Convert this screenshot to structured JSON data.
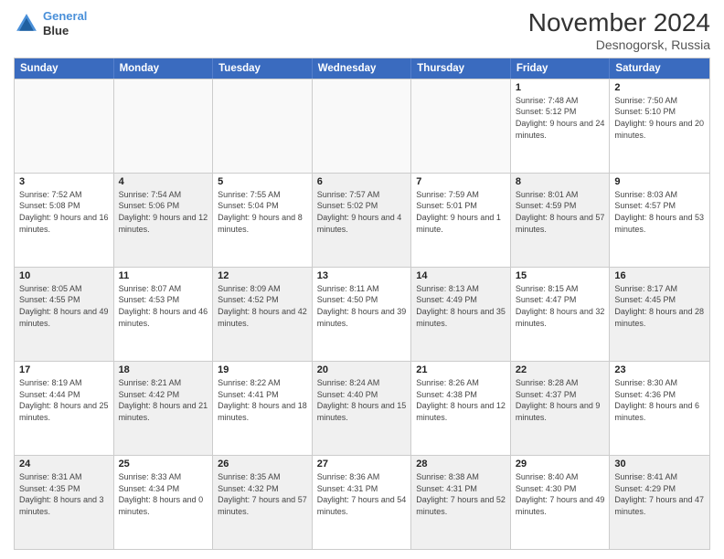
{
  "header": {
    "logo_line1": "General",
    "logo_line2": "Blue",
    "title": "November 2024",
    "subtitle": "Desnogorsk, Russia"
  },
  "days_of_week": [
    "Sunday",
    "Monday",
    "Tuesday",
    "Wednesday",
    "Thursday",
    "Friday",
    "Saturday"
  ],
  "weeks": [
    [
      {
        "day": "",
        "empty": true
      },
      {
        "day": "",
        "empty": true
      },
      {
        "day": "",
        "empty": true
      },
      {
        "day": "",
        "empty": true
      },
      {
        "day": "",
        "empty": true
      },
      {
        "day": "1",
        "info": "Sunrise: 7:48 AM\nSunset: 5:12 PM\nDaylight: 9 hours and 24 minutes."
      },
      {
        "day": "2",
        "info": "Sunrise: 7:50 AM\nSunset: 5:10 PM\nDaylight: 9 hours and 20 minutes."
      }
    ],
    [
      {
        "day": "3",
        "info": "Sunrise: 7:52 AM\nSunset: 5:08 PM\nDaylight: 9 hours and 16 minutes."
      },
      {
        "day": "4",
        "info": "Sunrise: 7:54 AM\nSunset: 5:06 PM\nDaylight: 9 hours and 12 minutes."
      },
      {
        "day": "5",
        "info": "Sunrise: 7:55 AM\nSunset: 5:04 PM\nDaylight: 9 hours and 8 minutes."
      },
      {
        "day": "6",
        "info": "Sunrise: 7:57 AM\nSunset: 5:02 PM\nDaylight: 9 hours and 4 minutes."
      },
      {
        "day": "7",
        "info": "Sunrise: 7:59 AM\nSunset: 5:01 PM\nDaylight: 9 hours and 1 minute."
      },
      {
        "day": "8",
        "info": "Sunrise: 8:01 AM\nSunset: 4:59 PM\nDaylight: 8 hours and 57 minutes."
      },
      {
        "day": "9",
        "info": "Sunrise: 8:03 AM\nSunset: 4:57 PM\nDaylight: 8 hours and 53 minutes."
      }
    ],
    [
      {
        "day": "10",
        "info": "Sunrise: 8:05 AM\nSunset: 4:55 PM\nDaylight: 8 hours and 49 minutes."
      },
      {
        "day": "11",
        "info": "Sunrise: 8:07 AM\nSunset: 4:53 PM\nDaylight: 8 hours and 46 minutes."
      },
      {
        "day": "12",
        "info": "Sunrise: 8:09 AM\nSunset: 4:52 PM\nDaylight: 8 hours and 42 minutes."
      },
      {
        "day": "13",
        "info": "Sunrise: 8:11 AM\nSunset: 4:50 PM\nDaylight: 8 hours and 39 minutes."
      },
      {
        "day": "14",
        "info": "Sunrise: 8:13 AM\nSunset: 4:49 PM\nDaylight: 8 hours and 35 minutes."
      },
      {
        "day": "15",
        "info": "Sunrise: 8:15 AM\nSunset: 4:47 PM\nDaylight: 8 hours and 32 minutes."
      },
      {
        "day": "16",
        "info": "Sunrise: 8:17 AM\nSunset: 4:45 PM\nDaylight: 8 hours and 28 minutes."
      }
    ],
    [
      {
        "day": "17",
        "info": "Sunrise: 8:19 AM\nSunset: 4:44 PM\nDaylight: 8 hours and 25 minutes."
      },
      {
        "day": "18",
        "info": "Sunrise: 8:21 AM\nSunset: 4:42 PM\nDaylight: 8 hours and 21 minutes."
      },
      {
        "day": "19",
        "info": "Sunrise: 8:22 AM\nSunset: 4:41 PM\nDaylight: 8 hours and 18 minutes."
      },
      {
        "day": "20",
        "info": "Sunrise: 8:24 AM\nSunset: 4:40 PM\nDaylight: 8 hours and 15 minutes."
      },
      {
        "day": "21",
        "info": "Sunrise: 8:26 AM\nSunset: 4:38 PM\nDaylight: 8 hours and 12 minutes."
      },
      {
        "day": "22",
        "info": "Sunrise: 8:28 AM\nSunset: 4:37 PM\nDaylight: 8 hours and 9 minutes."
      },
      {
        "day": "23",
        "info": "Sunrise: 8:30 AM\nSunset: 4:36 PM\nDaylight: 8 hours and 6 minutes."
      }
    ],
    [
      {
        "day": "24",
        "info": "Sunrise: 8:31 AM\nSunset: 4:35 PM\nDaylight: 8 hours and 3 minutes."
      },
      {
        "day": "25",
        "info": "Sunrise: 8:33 AM\nSunset: 4:34 PM\nDaylight: 8 hours and 0 minutes."
      },
      {
        "day": "26",
        "info": "Sunrise: 8:35 AM\nSunset: 4:32 PM\nDaylight: 7 hours and 57 minutes."
      },
      {
        "day": "27",
        "info": "Sunrise: 8:36 AM\nSunset: 4:31 PM\nDaylight: 7 hours and 54 minutes."
      },
      {
        "day": "28",
        "info": "Sunrise: 8:38 AM\nSunset: 4:31 PM\nDaylight: 7 hours and 52 minutes."
      },
      {
        "day": "29",
        "info": "Sunrise: 8:40 AM\nSunset: 4:30 PM\nDaylight: 7 hours and 49 minutes."
      },
      {
        "day": "30",
        "info": "Sunrise: 8:41 AM\nSunset: 4:29 PM\nDaylight: 7 hours and 47 minutes."
      }
    ]
  ]
}
